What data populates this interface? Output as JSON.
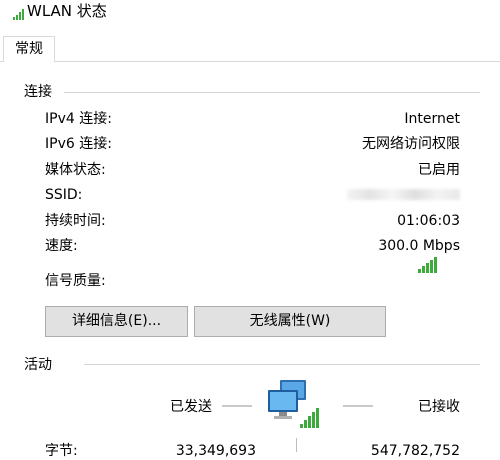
{
  "window": {
    "title": "WLAN 状态"
  },
  "tabs": [
    {
      "label": "常规"
    }
  ],
  "connection": {
    "title": "连接",
    "rows": [
      {
        "label": "IPv4 连接:",
        "value": "Internet"
      },
      {
        "label": "IPv6 连接:",
        "value": "无网络访问权限"
      },
      {
        "label": "媒体状态:",
        "value": "已启用"
      },
      {
        "label": "SSID:",
        "value": ""
      },
      {
        "label": "持续时间:",
        "value": "01:06:03"
      },
      {
        "label": "速度:",
        "value": "300.0 Mbps"
      }
    ],
    "signal": {
      "label": "信号质量:",
      "bars_filled": 5,
      "bars_total": 5
    },
    "details_button": "详细信息(E)...",
    "wireless_properties_button": "无线属性(W)"
  },
  "activity": {
    "title": "活动",
    "sent_label": "已发送",
    "received_label": "已接收",
    "bytes_label": "字节:",
    "bytes_sent": "33,349,693",
    "bytes_received": "547,782,752"
  },
  "colors": {
    "signal_green": "#3cab3c",
    "button_bg": "#e1e1e1",
    "group_line": "#d5d5d5"
  }
}
